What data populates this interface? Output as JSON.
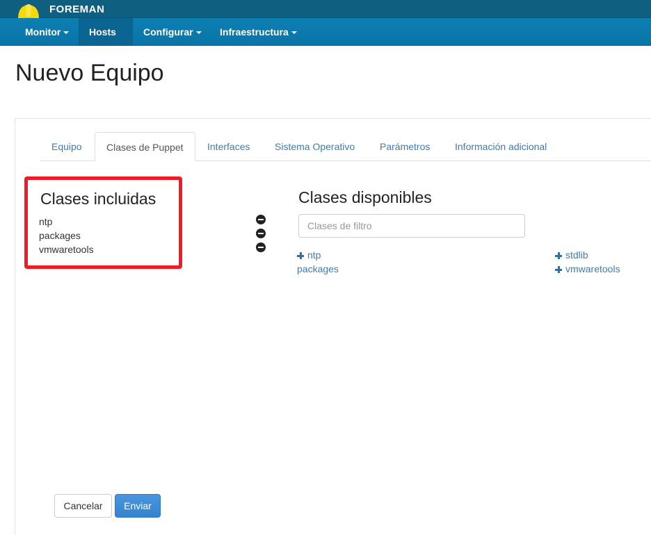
{
  "brand": {
    "name": "FOREMAN"
  },
  "nav": {
    "items": [
      {
        "label": "Monitor"
      },
      {
        "label": "Hosts"
      },
      {
        "label": "Configurar"
      },
      {
        "label": "Infraestructura"
      }
    ]
  },
  "page": {
    "title": "Nuevo Equipo"
  },
  "tabs": [
    {
      "label": "Equipo"
    },
    {
      "label": "Clases de Puppet"
    },
    {
      "label": "Interfaces"
    },
    {
      "label": "Sistema Operativo"
    },
    {
      "label": "Parámetros"
    },
    {
      "label": "Información adicional"
    }
  ],
  "included": {
    "title": "Clases incluidas",
    "items": [
      "ntp",
      "packages",
      "vmwaretools"
    ]
  },
  "available": {
    "title": "Clases disponibles",
    "filter_placeholder": "Clases de filtro",
    "items": [
      {
        "label": "ntp",
        "icon": "plus-icon"
      },
      {
        "label": "packages"
      },
      {
        "label": "stdlib",
        "icon": "plus-icon"
      },
      {
        "label": "vmwaretools",
        "icon": "plus-icon"
      }
    ]
  },
  "actions": {
    "cancel_label": "Cancelar",
    "submit_label": "Enviar"
  },
  "colors": {
    "brand_bar": "#0f5f80",
    "nav_bar": "#0a7cb0",
    "highlight_border": "#ee1c25",
    "link": "#3a7cb8",
    "primary_button": "#3b8ad8"
  }
}
